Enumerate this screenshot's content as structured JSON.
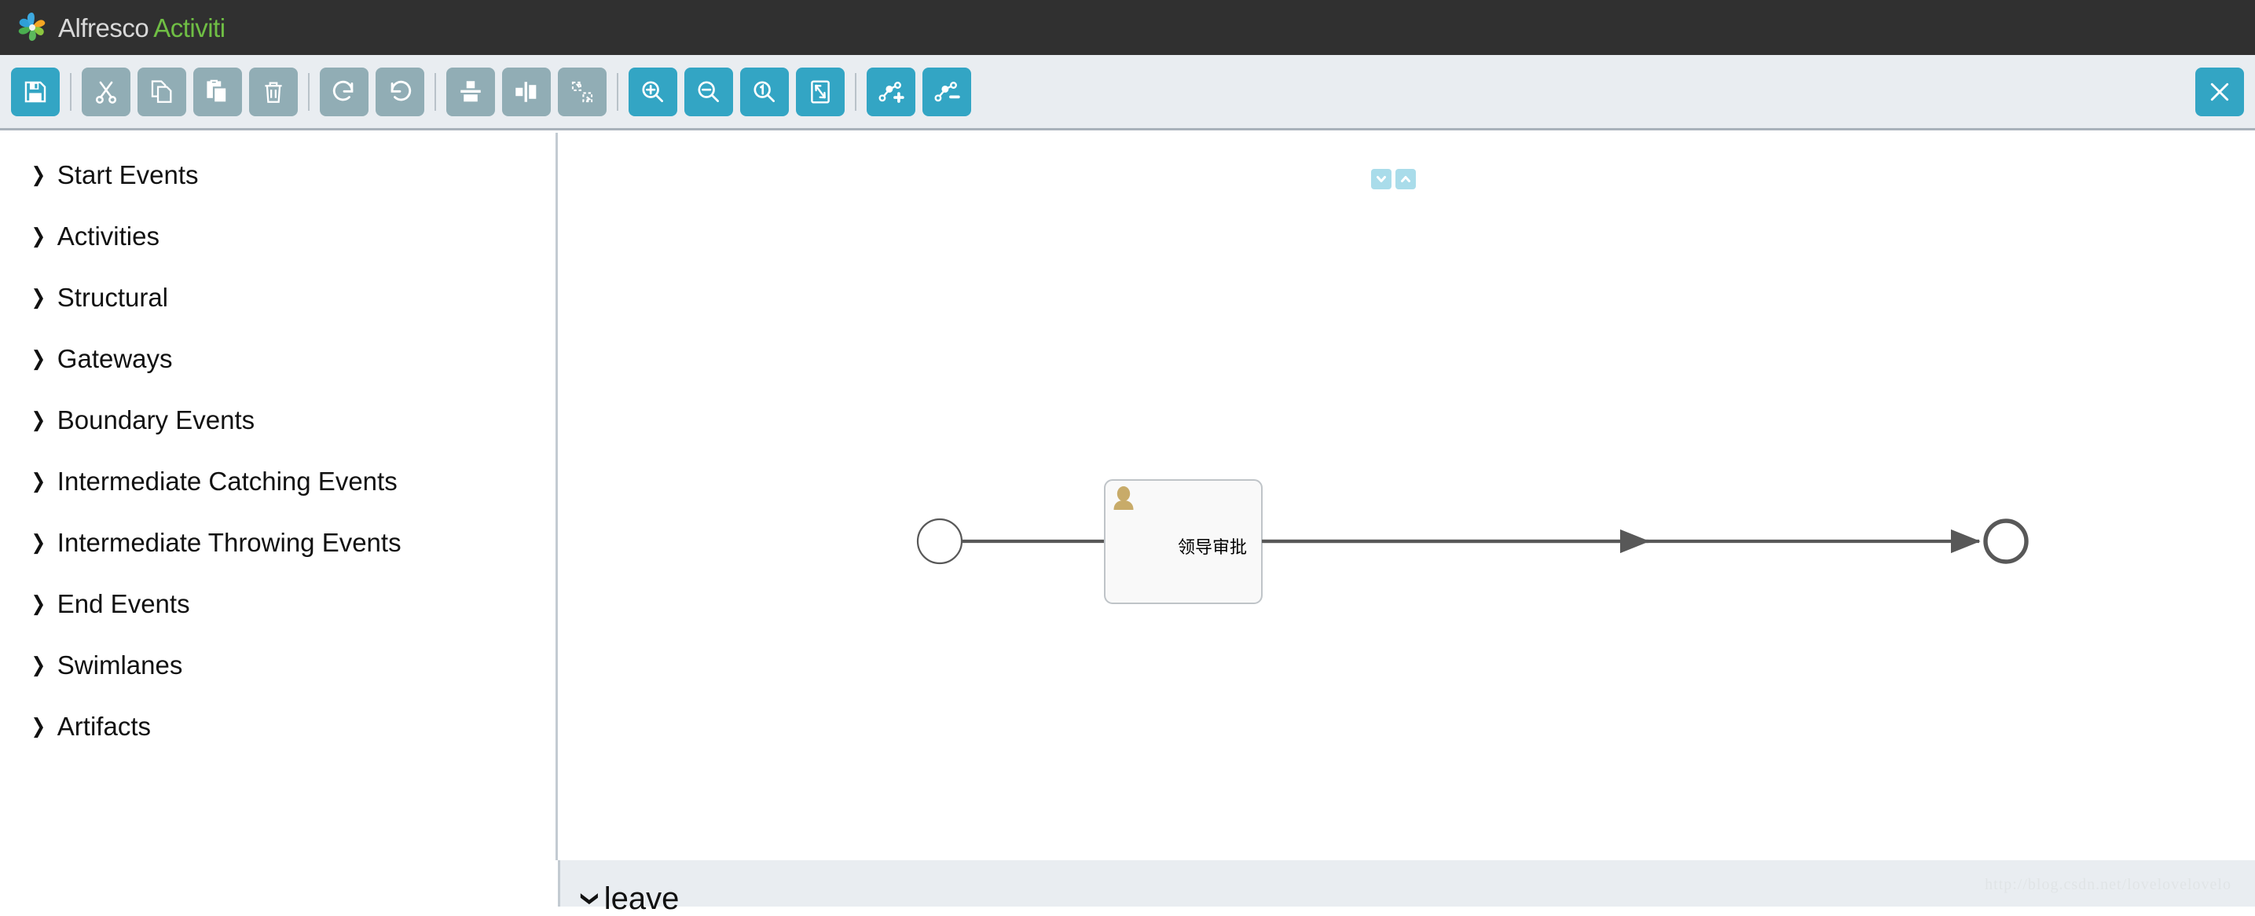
{
  "header": {
    "brand_primary": "Alfresco",
    "brand_secondary": "Activiti",
    "logo_icon": "alfresco-pinwheel-logo",
    "background_color": "#303030",
    "brand_secondary_color": "#6fbe44"
  },
  "toolbar": {
    "accent_color": "#33a5c4",
    "disabled_color": "#91adb5",
    "background_color": "#e9edf1",
    "buttons": [
      {
        "name": "save-button",
        "icon": "save-icon",
        "label": "Save",
        "state": "enabled"
      },
      {
        "name": "cut-button",
        "icon": "scissors-icon",
        "label": "Cut",
        "state": "disabled"
      },
      {
        "name": "copy-button",
        "icon": "copy-icon",
        "label": "Copy",
        "state": "disabled"
      },
      {
        "name": "paste-button",
        "icon": "paste-icon",
        "label": "Paste",
        "state": "disabled"
      },
      {
        "name": "delete-button",
        "icon": "trash-icon",
        "label": "Delete",
        "state": "disabled"
      },
      {
        "name": "redo-button",
        "icon": "redo-arrow-icon",
        "label": "Redo",
        "state": "disabled"
      },
      {
        "name": "undo-button",
        "icon": "undo-arrow-icon",
        "label": "Undo",
        "state": "disabled"
      },
      {
        "name": "align-vertical-button",
        "icon": "align-vertical-icon",
        "label": "Align vertical",
        "state": "disabled"
      },
      {
        "name": "align-horizontal-button",
        "icon": "align-horizontal-icon",
        "label": "Align horizontal",
        "state": "disabled"
      },
      {
        "name": "same-size-button",
        "icon": "same-size-icon",
        "label": "Same size",
        "state": "disabled"
      },
      {
        "name": "zoom-in-button",
        "icon": "zoom-in-icon",
        "label": "Zoom in",
        "state": "enabled"
      },
      {
        "name": "zoom-out-button",
        "icon": "zoom-out-icon",
        "label": "Zoom out",
        "state": "enabled"
      },
      {
        "name": "zoom-actual-button",
        "icon": "zoom-actual-size-icon",
        "label": "Zoom actual size",
        "state": "enabled"
      },
      {
        "name": "zoom-fit-button",
        "icon": "zoom-fit-icon",
        "label": "Zoom to fit",
        "state": "enabled"
      },
      {
        "name": "add-bendpoint-button",
        "icon": "bendpoint-add-icon",
        "label": "Add bendpoint",
        "state": "enabled"
      },
      {
        "name": "remove-bendpoint-button",
        "icon": "bendpoint-remove-icon",
        "label": "Remove bendpoint",
        "state": "enabled"
      }
    ],
    "close_button": {
      "name": "close-editor-button",
      "icon": "close-x-icon",
      "label": "X",
      "state": "enabled"
    }
  },
  "palette": {
    "items": [
      {
        "label": "Start Events",
        "icon": "chevron-right-icon"
      },
      {
        "label": "Activities",
        "icon": "chevron-right-icon"
      },
      {
        "label": "Structural",
        "icon": "chevron-right-icon"
      },
      {
        "label": "Gateways",
        "icon": "chevron-right-icon"
      },
      {
        "label": "Boundary Events",
        "icon": "chevron-right-icon"
      },
      {
        "label": "Intermediate Catching Events",
        "icon": "chevron-right-icon"
      },
      {
        "label": "Intermediate Throwing Events",
        "icon": "chevron-right-icon"
      },
      {
        "label": "End Events",
        "icon": "chevron-right-icon"
      },
      {
        "label": "Swimlanes",
        "icon": "chevron-right-icon"
      },
      {
        "label": "Artifacts",
        "icon": "chevron-right-icon"
      }
    ]
  },
  "canvas": {
    "widget_buttons": [
      {
        "name": "collapse-down-button",
        "icon": "chevron-down-icon"
      },
      {
        "name": "collapse-up-button",
        "icon": "chevron-up-icon"
      }
    ],
    "diagram": {
      "type": "bpmn-process",
      "nodes": [
        {
          "id": "startEvent",
          "kind": "start-event",
          "label": "",
          "shape": "circle-thin"
        },
        {
          "id": "userTask",
          "kind": "user-task",
          "label": "领导审批",
          "shape": "rounded-rectangle",
          "marker_icon": "user-person-icon",
          "marker_color": "#c8ab69"
        },
        {
          "id": "endEvent",
          "kind": "end-event",
          "label": "",
          "shape": "circle-thick"
        }
      ],
      "flows": [
        {
          "from": "startEvent",
          "to": "userTask",
          "kind": "sequence-flow"
        },
        {
          "from": "userTask",
          "to": "endEvent",
          "kind": "sequence-flow"
        }
      ]
    }
  },
  "bottom_panel": {
    "chevron_icon": "chevron-down-icon",
    "title": "leave"
  },
  "watermark": {
    "text": "http://blog.csdn.net/lovelovelovelo"
  }
}
